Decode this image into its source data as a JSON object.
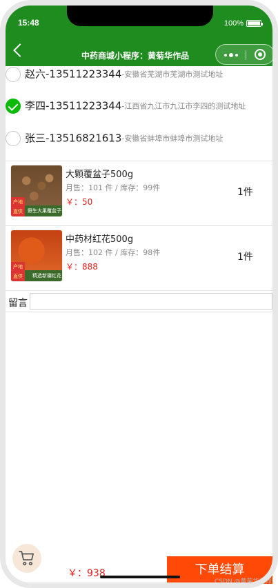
{
  "status_bar": {
    "time": "15:48",
    "battery": "100%",
    "battery_level": 1.0
  },
  "navbar": {
    "title": "中药商城小程序：黄菊华作品",
    "back_icon": "chevron-left-icon",
    "menu_icon": "more-dots-icon",
    "close_icon": "target-circle-icon"
  },
  "addresses": [
    {
      "name": "赵六-13511223344",
      "detail": "-安徽省芜湖市芜湖市测试地址",
      "selected": false
    },
    {
      "name": "李四-13511223344",
      "detail": "-江西省九江市九江市李四的测试地址",
      "selected": true
    },
    {
      "name": "张三-13516821613",
      "detail": "-安徽省蚌埠市蚌埠市测试地址",
      "selected": false
    }
  ],
  "items": [
    {
      "name": "大颗覆盆子500g",
      "stats": "月售：101 件 / 库存：99件",
      "price": "￥：50",
      "qty": "1件",
      "thumb_badge": "野生大果覆盆子",
      "thumb_tag": "产地直供"
    },
    {
      "name": "中药材红花500g",
      "stats": "月售：102 件 / 库存：98件",
      "price": "￥：888",
      "qty": "1件",
      "thumb_badge": "精选新疆红花",
      "thumb_tag": "产地直供"
    }
  ],
  "memo": {
    "label": "留言",
    "value": "",
    "placeholder": ""
  },
  "footer": {
    "total": "￥：938",
    "checkout_label": "下单结算",
    "cart_icon": "cart-icon"
  },
  "watermark": "CSDN @黄菊华老师",
  "colors": {
    "header": "#1e8c1e",
    "price": "#e02020",
    "checkout": "#ff4a07",
    "radio_selected": "#09bb07"
  }
}
